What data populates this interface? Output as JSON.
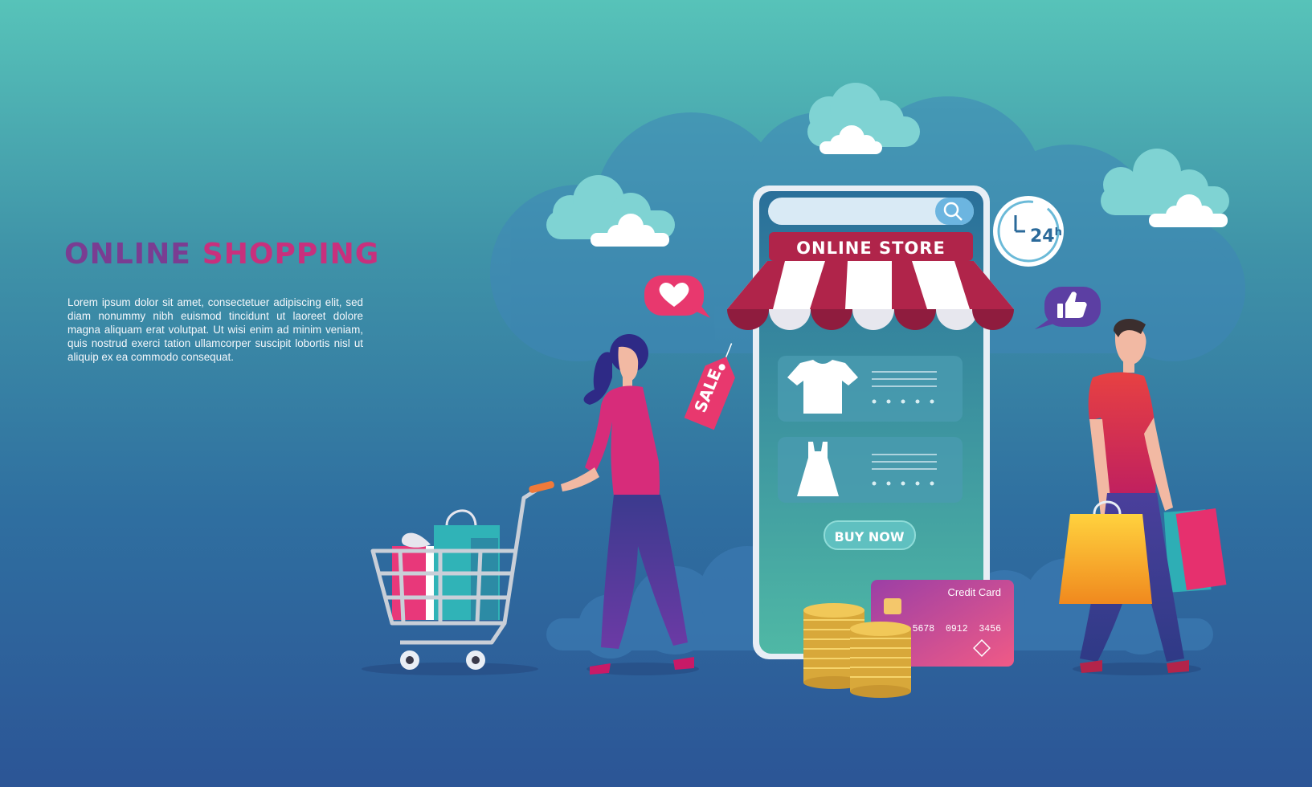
{
  "hero": {
    "title_part1": "ONLINE",
    "title_part2": "SHOPPING",
    "body": "Lorem ipsum dolor sit amet, consectetuer adipiscing elit, sed diam nonummy nibh euismod tincidunt ut laoreet dolore magna aliquam erat volutpat. Ut wisi enim ad minim veniam, quis nostrud exerci tation ullamcorper suscipit lobortis nisl ut aliquip ex ea commodo consequat."
  },
  "phone": {
    "store_sign": "ONLINE STORE",
    "buy_button": "BUY NOW",
    "products": [
      {
        "icon": "shirt-icon",
        "rating": 5
      },
      {
        "icon": "dress-icon",
        "rating": 5
      }
    ]
  },
  "tags": {
    "sale": "SALE"
  },
  "badges": {
    "hours": "24",
    "hours_suffix": "h"
  },
  "credit_card": {
    "label": "Credit Card",
    "number": "5678  0912  3456"
  },
  "icons": [
    "search-icon",
    "heart-icon",
    "thumbs-up-icon",
    "clock-24h-icon",
    "shopping-cart-icon",
    "gift-box-icon",
    "shopping-bag-icon",
    "coin-stack-icon",
    "card-chip-icon",
    "cloud-icon"
  ],
  "colors": {
    "bg_top": "#57c3b9",
    "bg_bottom": "#2c5596",
    "title_part1": "#7a3d92",
    "title_part2": "#c8307d",
    "awning_red": "#b0244a",
    "card_pink": "#e0447e",
    "coin_gold": "#e3b53f"
  }
}
